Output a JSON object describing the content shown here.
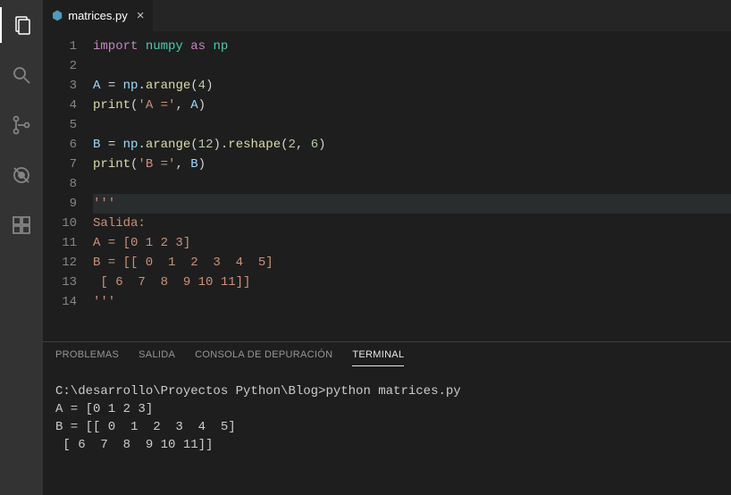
{
  "tab": {
    "filename": "matrices.py",
    "icon_glyph": "⬢"
  },
  "code": {
    "lines": [
      {
        "n": 1,
        "html": "<span class='tok-key'>import</span> <span class='tok-mod'>numpy</span> <span class='tok-key'>as</span> <span class='tok-mod'>np</span>"
      },
      {
        "n": 2,
        "html": ""
      },
      {
        "n": 3,
        "html": "<span class='tok-id'>A</span> <span class='tok-pun'>=</span> <span class='tok-id'>np</span><span class='tok-pun'>.</span><span class='tok-fn'>arange</span><span class='tok-pun'>(</span><span class='tok-num'>4</span><span class='tok-pun'>)</span>"
      },
      {
        "n": 4,
        "html": "<span class='tok-fn'>print</span><span class='tok-pun'>(</span><span class='tok-str'>'A ='</span><span class='tok-pun'>,</span> <span class='tok-id'>A</span><span class='tok-pun'>)</span>"
      },
      {
        "n": 5,
        "html": ""
      },
      {
        "n": 6,
        "html": "<span class='tok-id'>B</span> <span class='tok-pun'>=</span> <span class='tok-id'>np</span><span class='tok-pun'>.</span><span class='tok-fn'>arange</span><span class='tok-pun'>(</span><span class='tok-num'>12</span><span class='tok-pun'>)</span><span class='tok-pun'>.</span><span class='tok-fn'>reshape</span><span class='tok-pun'>(</span><span class='tok-num'>2</span><span class='tok-pun'>,</span> <span class='tok-num'>6</span><span class='tok-pun'>)</span>"
      },
      {
        "n": 7,
        "html": "<span class='tok-fn'>print</span><span class='tok-pun'>(</span><span class='tok-str'>'B ='</span><span class='tok-pun'>,</span> <span class='tok-id'>B</span><span class='tok-pun'>)</span>"
      },
      {
        "n": 8,
        "html": ""
      },
      {
        "n": 9,
        "html": "<span class='tok-str'>'''</span>",
        "current": true
      },
      {
        "n": 10,
        "html": "<span class='tok-str'>Salida:</span>"
      },
      {
        "n": 11,
        "html": "<span class='tok-str'>A = [0 1 2 3]</span>"
      },
      {
        "n": 12,
        "html": "<span class='tok-str'>B = [[ 0  1  2  3  4  5]</span>"
      },
      {
        "n": 13,
        "html": "<span class='tok-str'> [ 6  7  8  9 10 11]]</span>"
      },
      {
        "n": 14,
        "html": "<span class='tok-str'>'''</span>"
      }
    ]
  },
  "panel": {
    "tabs": [
      "PROBLEMAS",
      "SALIDA",
      "CONSOLA DE DEPURACIÓN",
      "TERMINAL"
    ],
    "active_index": 3
  },
  "terminal": {
    "content": "C:\\desarrollo\\Proyectos Python\\Blog>python matrices.py\nA = [0 1 2 3]\nB = [[ 0  1  2  3  4  5]\n [ 6  7  8  9 10 11]]"
  },
  "activity": {
    "items": [
      "explorer-icon",
      "search-icon",
      "source-control-icon",
      "debug-icon",
      "extensions-icon"
    ]
  }
}
